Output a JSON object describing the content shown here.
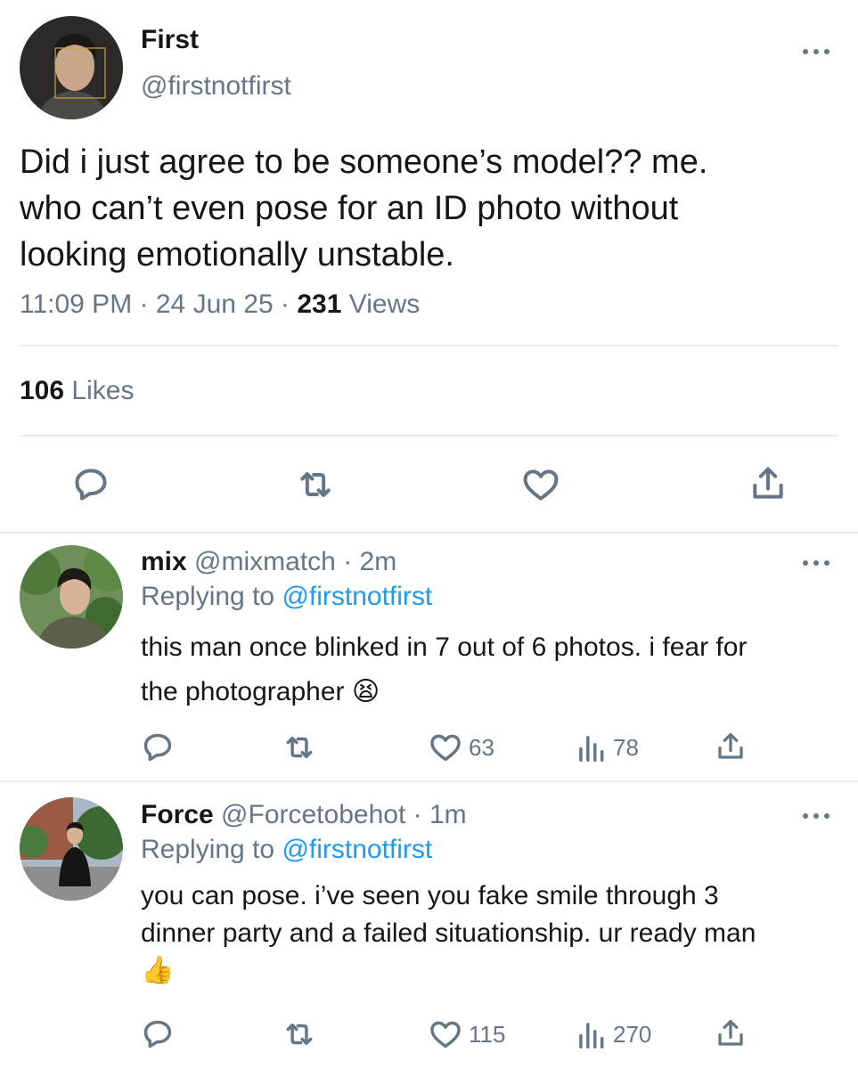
{
  "main_tweet": {
    "display_name": "First",
    "handle": "@firstnotfirst",
    "text_lines": [
      "Did i just agree to be someone’s model?? me.",
      "who can’t even pose for an ID photo without",
      "looking emotionally unstable."
    ],
    "time": "11:09 PM",
    "date": "24 Jun 25",
    "views_count": "231",
    "views_label": "Views",
    "likes_count": "106",
    "likes_label": "Likes",
    "separator": "·"
  },
  "replies": [
    {
      "display_name": "mix",
      "handle": "@mixmatch",
      "time": "· 2m",
      "replying_label": "Replying to",
      "replying_to": "@firstnotfirst",
      "text_lines": [
        "this man once blinked in 7 out of 6 photos. i fear for",
        "the photographer 😫"
      ],
      "likes": "63",
      "views": "78"
    },
    {
      "display_name": "Force",
      "handle": "@Forcetobehot",
      "time": "· 1m",
      "replying_label": "Replying to",
      "replying_to": "@firstnotfirst",
      "text_lines": [
        "you can pose. i’ve seen you fake smile through 3",
        "dinner party and a failed situationship. ur ready man",
        "👍"
      ],
      "likes": "115",
      "views": "270"
    }
  ],
  "icons": [
    "more-icon",
    "reply-icon",
    "retweet-icon",
    "like-icon",
    "share-icon",
    "views-icon"
  ],
  "colors": {
    "link": "#1d9bf0",
    "secondary": "#657786",
    "text": "#0f1419",
    "divider": "#e6ecf0"
  }
}
